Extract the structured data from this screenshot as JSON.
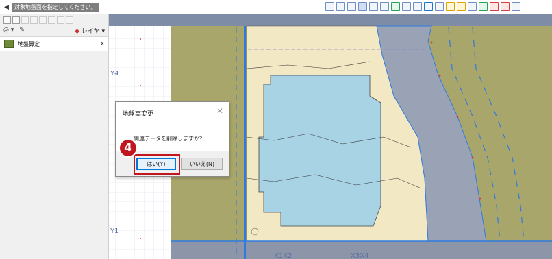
{
  "topbar": {
    "back_icon": "◀",
    "hint_message": "対象地盤面を指定してください。",
    "tool_icons": [
      "view-icon",
      "grid-icon",
      "filter-icon",
      "select-icon",
      "snap-icon",
      "layer-icon",
      "measure-icon",
      "display-icon",
      "zoom-icon",
      "undo-icon",
      "redo-icon",
      "light-icon",
      "paint-icon",
      "person-icon",
      "tree-icon",
      "move-icon",
      "copy-icon",
      "table-icon"
    ]
  },
  "sidebar": {
    "layer_label": "レイヤ",
    "panel_title": "地盤算定",
    "collapse_icon": "«"
  },
  "plan": {
    "axis_labels": [
      "Y4",
      "Y1",
      "X1X2",
      "X3X4"
    ]
  },
  "dialog": {
    "title": "地盤高変更",
    "close": "✕",
    "message": "関連データを削除しますか？",
    "yes_label": "はい(Y)",
    "no_label": "いいえ(N)"
  },
  "annotation": {
    "step_number": "4",
    "accent_color": "#c0171f"
  },
  "colors": {
    "ground": "#a9a66b",
    "sidewalk": "#9aa3b6",
    "building": "#a7d3e4",
    "site": "#f3e8c4",
    "wall_blue": "#2e7be0"
  }
}
